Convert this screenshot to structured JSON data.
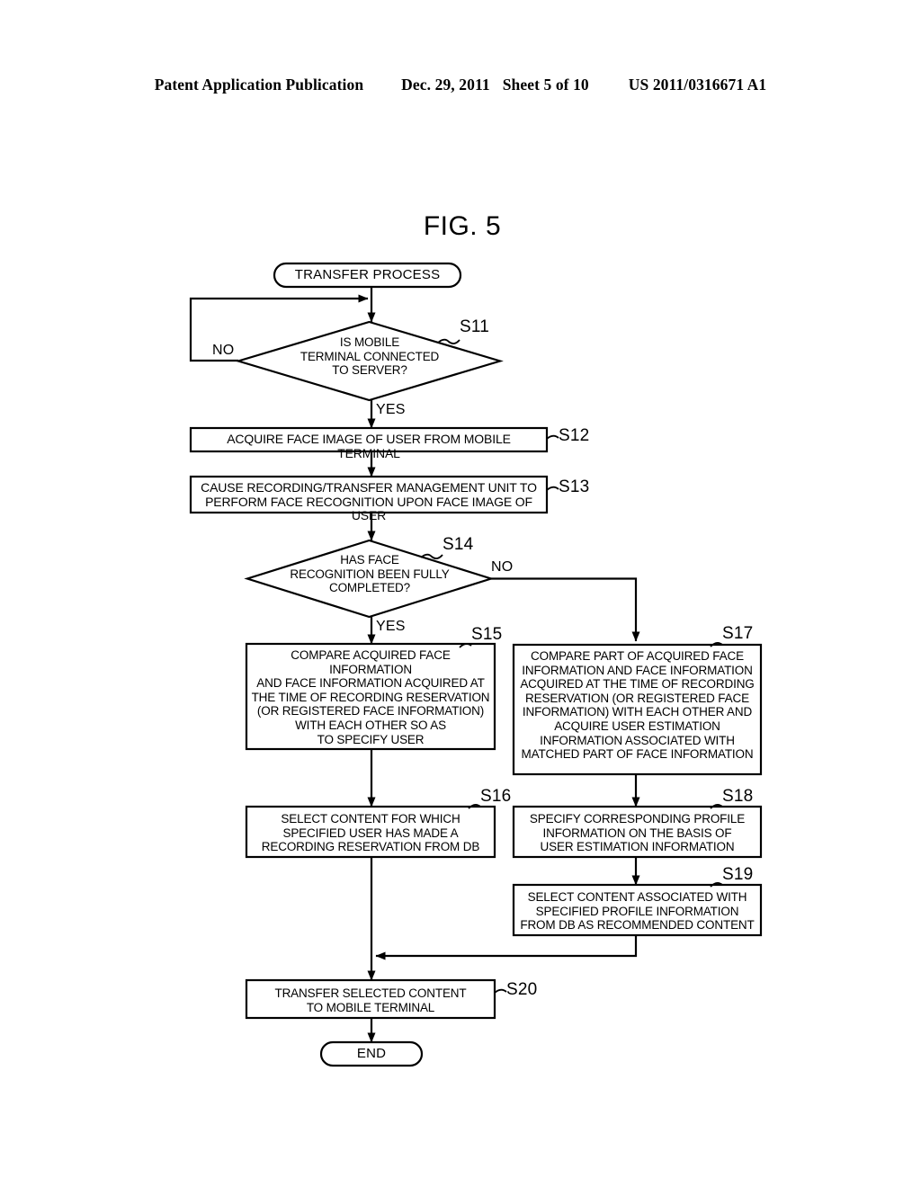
{
  "header": {
    "publication": "Patent Application Publication",
    "date": "Dec. 29, 2011",
    "sheet": "Sheet 5 of 10",
    "patent_number": "US 2011/0316671 A1"
  },
  "figure": {
    "title": "FIG. 5"
  },
  "flowchart": {
    "start": {
      "label": "TRANSFER PROCESS",
      "shape": "terminator"
    },
    "end": {
      "label": "END",
      "shape": "terminator"
    },
    "steps": [
      {
        "id": "S11",
        "ref": "S11",
        "shape": "decision",
        "text": "IS MOBILE\nTERMINAL CONNECTED\nTO SERVER?",
        "branches": {
          "no": "NO",
          "yes": "YES"
        }
      },
      {
        "id": "S12",
        "ref": "S12",
        "shape": "process",
        "text": "ACQUIRE FACE IMAGE OF USER FROM MOBILE TERMINAL"
      },
      {
        "id": "S13",
        "ref": "S13",
        "shape": "process",
        "text": "CAUSE RECORDING/TRANSFER MANAGEMENT UNIT TO\nPERFORM FACE RECOGNITION UPON FACE IMAGE OF USER"
      },
      {
        "id": "S14",
        "ref": "S14",
        "shape": "decision",
        "text": "HAS FACE\nRECOGNITION BEEN FULLY\nCOMPLETED?",
        "branches": {
          "no": "NO",
          "yes": "YES"
        }
      },
      {
        "id": "S15",
        "ref": "S15",
        "shape": "process",
        "text": "COMPARE ACQUIRED FACE INFORMATION\nAND FACE INFORMATION ACQUIRED AT\nTHE TIME OF RECORDING RESERVATION\n(OR REGISTERED FACE INFORMATION)\nWITH EACH OTHER SO AS\nTO SPECIFY USER"
      },
      {
        "id": "S16",
        "ref": "S16",
        "shape": "process",
        "text": "SELECT CONTENT FOR WHICH\nSPECIFIED USER HAS MADE A\nRECORDING RESERVATION FROM DB"
      },
      {
        "id": "S17",
        "ref": "S17",
        "shape": "process",
        "text": "COMPARE PART OF ACQUIRED FACE\nINFORMATION AND FACE INFORMATION\nACQUIRED AT THE TIME OF RECORDING\nRESERVATION (OR REGISTERED FACE\nINFORMATION) WITH EACH OTHER AND\nACQUIRE USER ESTIMATION\nINFORMATION ASSOCIATED WITH\nMATCHED PART OF FACE INFORMATION"
      },
      {
        "id": "S18",
        "ref": "S18",
        "shape": "process",
        "text": "SPECIFY CORRESPONDING PROFILE\nINFORMATION ON THE BASIS OF\nUSER ESTIMATION INFORMATION"
      },
      {
        "id": "S19",
        "ref": "S19",
        "shape": "process",
        "text": "SELECT CONTENT ASSOCIATED WITH\nSPECIFIED PROFILE INFORMATION\nFROM DB AS RECOMMENDED CONTENT"
      },
      {
        "id": "S20",
        "ref": "S20",
        "shape": "process",
        "text": "TRANSFER SELECTED CONTENT\nTO MOBILE TERMINAL"
      }
    ],
    "branch_labels": {
      "s11_no": "NO",
      "s11_yes": "YES",
      "s14_no": "NO",
      "s14_yes": "YES"
    }
  }
}
